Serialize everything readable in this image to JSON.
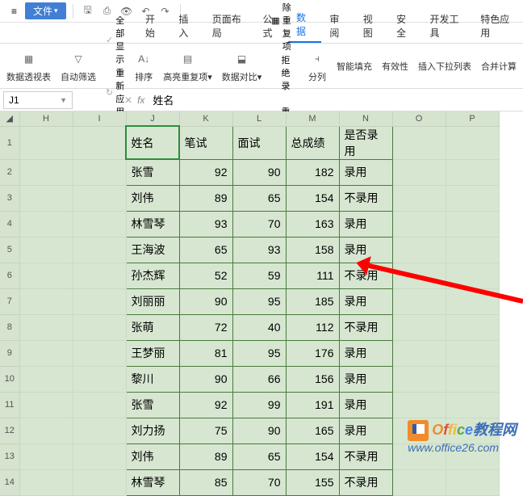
{
  "menubar": {
    "file": "文件"
  },
  "tabs": [
    "开始",
    "插入",
    "页面布局",
    "公式",
    "数据",
    "审阅",
    "视图",
    "安全",
    "开发工具",
    "特色应用"
  ],
  "active_tab_index": 4,
  "ribbon": {
    "pivot": "数据透视表",
    "autofilter": "自动筛选",
    "showall": "全部显示",
    "reapply": "重新应用",
    "sort": "排序",
    "highlight": "高亮重复项",
    "datacompare": "数据对比",
    "removedupes": "删除重复项",
    "rejectdupes": "拒绝录入重复项",
    "textcols": "分列",
    "smartfill": "智能填充",
    "validation": "有效性",
    "dropdown": "插入下拉列表",
    "consolidate": "合并计算"
  },
  "name_box": "J1",
  "formula": "姓名",
  "columns": [
    "H",
    "I",
    "J",
    "K",
    "L",
    "M",
    "N",
    "O",
    "P"
  ],
  "headers": {
    "name": "姓名",
    "written": "笔试",
    "interview": "面试",
    "total": "总成绩",
    "hired": "是否录用"
  },
  "rows": [
    {
      "name": "张雪",
      "written": 92,
      "interview": 90,
      "total": 182,
      "hired": "录用"
    },
    {
      "name": "刘伟",
      "written": 89,
      "interview": 65,
      "total": 154,
      "hired": "不录用"
    },
    {
      "name": "林雪琴",
      "written": 93,
      "interview": 70,
      "total": 163,
      "hired": "录用"
    },
    {
      "name": "王海波",
      "written": 65,
      "interview": 93,
      "total": 158,
      "hired": "录用"
    },
    {
      "name": "孙杰辉",
      "written": 52,
      "interview": 59,
      "total": 111,
      "hired": "不录用"
    },
    {
      "name": "刘丽丽",
      "written": 90,
      "interview": 95,
      "total": 185,
      "hired": "录用"
    },
    {
      "name": "张萌",
      "written": 72,
      "interview": 40,
      "total": 112,
      "hired": "不录用"
    },
    {
      "name": "王梦丽",
      "written": 81,
      "interview": 95,
      "total": 176,
      "hired": "录用"
    },
    {
      "name": "黎川",
      "written": 90,
      "interview": 66,
      "total": 156,
      "hired": "录用"
    },
    {
      "name": "张雪",
      "written": 92,
      "interview": 99,
      "total": 191,
      "hired": "录用"
    },
    {
      "name": "刘力扬",
      "written": 75,
      "interview": 90,
      "total": 165,
      "hired": "录用"
    },
    {
      "name": "刘伟",
      "written": 89,
      "interview": 65,
      "total": 154,
      "hired": "不录用"
    },
    {
      "name": "林雪琴",
      "written": 85,
      "interview": 70,
      "total": 155,
      "hired": "不录用"
    }
  ],
  "watermark": {
    "brand": "Office",
    "suffix": "教程网",
    "url": "www.office26.com"
  }
}
